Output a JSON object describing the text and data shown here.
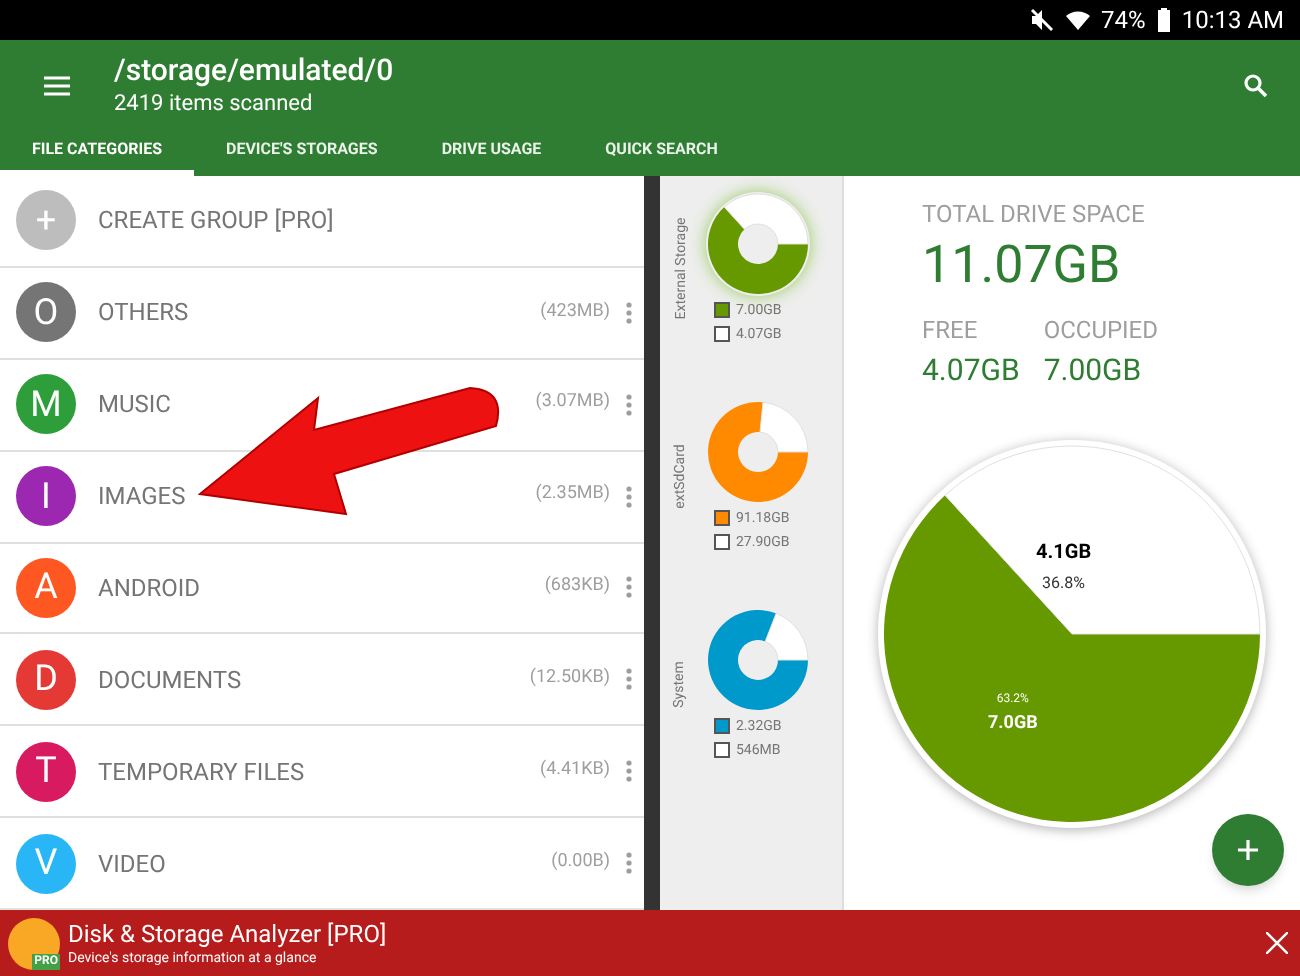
{
  "status_bar": {
    "battery": "74%",
    "time": "10:13 AM"
  },
  "header": {
    "title": "/storage/emulated/0",
    "subtitle": "2419 items scanned"
  },
  "tabs": [
    {
      "label": "FILE CATEGORIES",
      "selected": true
    },
    {
      "label": "DEVICE'S STORAGES",
      "selected": false
    },
    {
      "label": "DRIVE USAGE",
      "selected": false
    },
    {
      "label": "QUICK SEARCH",
      "selected": false
    }
  ],
  "categories": [
    {
      "kind": "action",
      "letter": "+",
      "label": "CREATE GROUP [PRO]",
      "color": "#bdbdbd"
    },
    {
      "kind": "category",
      "letter": "O",
      "label": "OTHERS",
      "size": "(423MB)",
      "color": "#757575"
    },
    {
      "kind": "category",
      "letter": "M",
      "label": "MUSIC",
      "size": "(3.07MB)",
      "color": "#2e9e3a"
    },
    {
      "kind": "category",
      "letter": "I",
      "label": "IMAGES",
      "size": "(2.35MB)",
      "color": "#9c27b0"
    },
    {
      "kind": "category",
      "letter": "A",
      "label": "ANDROID",
      "size": "(683KB)",
      "color": "#ff5722"
    },
    {
      "kind": "category",
      "letter": "D",
      "label": "DOCUMENTS",
      "size": "(12.50KB)",
      "color": "#e53935"
    },
    {
      "kind": "category",
      "letter": "T",
      "label": "TEMPORARY FILES",
      "size": "(4.41KB)",
      "color": "#d81b60"
    },
    {
      "kind": "category",
      "letter": "V",
      "label": "VIDEO",
      "size": "(0.00B)",
      "color": "#29b6f6"
    }
  ],
  "storages": [
    {
      "name": "External Storage",
      "selected": true,
      "legend": [
        {
          "label": "7.00GB",
          "color": "#669900"
        },
        {
          "label": "4.07GB",
          "color": "#ffffff"
        }
      ],
      "chart_data": {
        "type": "donut",
        "series": [
          {
            "values": [
              63.2,
              36.8
            ]
          }
        ]
      }
    },
    {
      "name": "extSdCard",
      "selected": false,
      "legend": [
        {
          "label": "91.18GB",
          "color": "#ff8a00"
        },
        {
          "label": "27.90GB",
          "color": "#ffffff"
        }
      ],
      "chart_data": {
        "type": "donut",
        "series": [
          {
            "values": [
              76.6,
              23.4
            ]
          }
        ]
      }
    },
    {
      "name": "System",
      "selected": false,
      "legend": [
        {
          "label": "2.32GB",
          "color": "#0099cc"
        },
        {
          "label": "546MB",
          "color": "#ffffff"
        }
      ],
      "chart_data": {
        "type": "donut",
        "series": [
          {
            "values": [
              80.9,
              19.1
            ]
          }
        ]
      }
    }
  ],
  "drive": {
    "total_label": "TOTAL DRIVE SPACE",
    "total": "11.07GB",
    "free_label": "FREE",
    "free": "4.07GB",
    "occupied_label": "OCCUPIED",
    "occupied": "7.00GB",
    "chart_data": {
      "type": "pie",
      "series": [
        {
          "values": [
            63.2,
            36.8
          ]
        }
      ],
      "value_labels": [
        {
          "size": "7.0GB",
          "percent": "63.2%",
          "color": "#669900"
        },
        {
          "size": "4.1GB",
          "percent": "36.8%",
          "color": "#ffffff"
        }
      ]
    }
  },
  "ad": {
    "title": "Disk & Storage Analyzer [PRO]",
    "subtitle": "Device's storage information at a glance",
    "badge": "PRO"
  }
}
